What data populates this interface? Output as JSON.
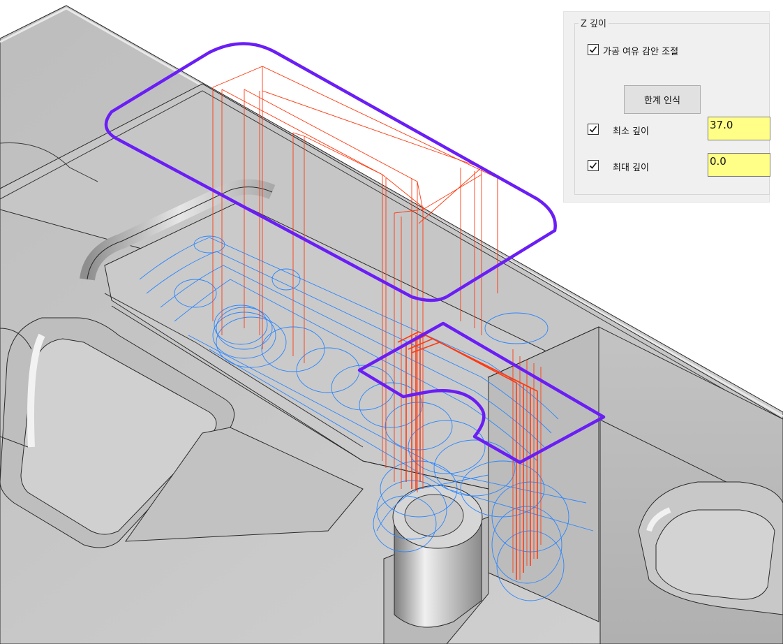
{
  "z_depth_panel": {
    "title": "Z 깊이",
    "stock_allowance_checkbox": {
      "label": "가공 여유 감안 조절",
      "checked": true
    },
    "detect_limits_button": {
      "label": "한계 인식"
    },
    "min_depth": {
      "label": "최소 깊이",
      "checked": true,
      "value": "37.0"
    },
    "max_depth": {
      "label": "최대 깊이",
      "checked": true,
      "value": "0.0"
    }
  },
  "viewport": {
    "colors": {
      "background": "#ffffff",
      "model_surface": "#c8c8c8",
      "boundary": "#6a1ef5",
      "toolpath_links": "#ff3a10",
      "toolpath_cuts": "#2a86ff"
    }
  }
}
